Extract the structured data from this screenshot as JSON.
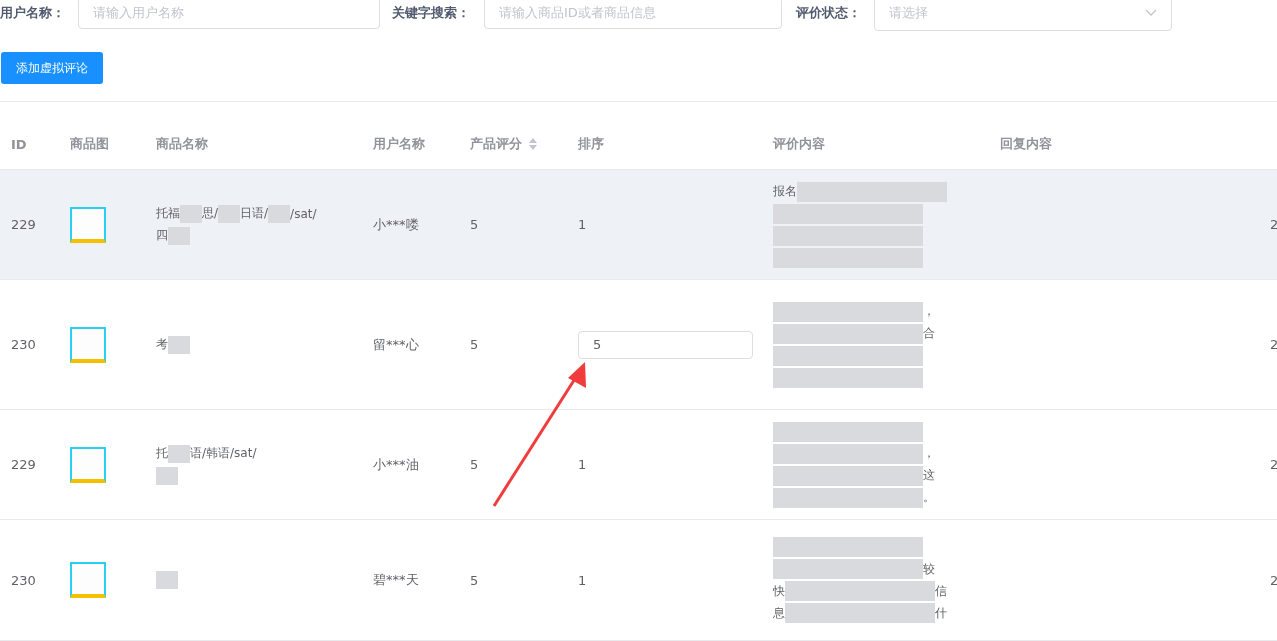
{
  "filters": [
    {
      "label": "用户名称：",
      "kind": "input",
      "placeholder": "请输入用户名称"
    },
    {
      "label": "关键字搜索：",
      "kind": "input",
      "placeholder": "请输入商品ID或者商品信息"
    },
    {
      "label": "评价状态：",
      "kind": "select",
      "placeholder": "请选择"
    }
  ],
  "add_button": "添加虚拟评论",
  "table": {
    "columns": [
      {
        "label": "ID",
        "sortable": false
      },
      {
        "label": "商品图",
        "sortable": false
      },
      {
        "label": "商品名称",
        "sortable": false
      },
      {
        "label": "用户名称",
        "sortable": false
      },
      {
        "label": "产品评分",
        "sortable": true
      },
      {
        "label": "排序",
        "sortable": false
      },
      {
        "label": "评价内容",
        "sortable": false
      },
      {
        "label": "回复内容",
        "sortable": false
      }
    ],
    "rows": [
      {
        "id": "229",
        "hovered": true,
        "name_lines": [
          [
            {
              "kind": "text",
              "text": "托福"
            },
            {
              "kind": "blur"
            },
            {
              "kind": "text",
              "text": "思/"
            },
            {
              "kind": "blur"
            },
            {
              "kind": "text",
              "text": "日语/"
            },
            {
              "kind": "blur"
            },
            {
              "kind": "text",
              "text": "/sat/"
            }
          ],
          [
            {
              "kind": "text",
              "text": "四"
            },
            {
              "kind": "blur"
            }
          ]
        ],
        "user": "小***喽",
        "score": "5",
        "sort": {
          "kind": "text",
          "value": "1"
        },
        "review_lines": [
          [
            {
              "kind": "text",
              "text": "报名"
            },
            {
              "kind": "blur"
            }
          ],
          [
            {
              "kind": "blur"
            }
          ],
          [
            {
              "kind": "blur"
            }
          ],
          [
            {
              "kind": "blur"
            }
          ]
        ],
        "column_9": "2"
      },
      {
        "id": "230",
        "hovered": false,
        "name_lines": [
          [
            {
              "kind": "text",
              "text": "考"
            },
            {
              "kind": "blur"
            }
          ]
        ],
        "user": "留***心",
        "score": "5",
        "sort": {
          "kind": "input",
          "value": "5"
        },
        "review_lines": [
          [
            {
              "kind": "blur"
            },
            {
              "kind": "text",
              "text": "，"
            }
          ],
          [
            {
              "kind": "blur"
            },
            {
              "kind": "text",
              "text": "合"
            }
          ],
          [
            {
              "kind": "blur"
            }
          ],
          [
            {
              "kind": "blur"
            }
          ]
        ],
        "column_9": "2"
      },
      {
        "id": "229",
        "hovered": false,
        "name_lines": [
          [
            {
              "kind": "text",
              "text": "托"
            },
            {
              "kind": "blur"
            },
            {
              "kind": "text",
              "text": "语/韩语/sat/"
            }
          ],
          [
            {
              "kind": "blur"
            }
          ]
        ],
        "user": "小***油",
        "score": "5",
        "sort": {
          "kind": "text",
          "value": "1"
        },
        "review_lines": [
          [
            {
              "kind": "blur"
            }
          ],
          [
            {
              "kind": "blur"
            },
            {
              "kind": "text",
              "text": "，"
            }
          ],
          [
            {
              "kind": "blur"
            },
            {
              "kind": "text",
              "text": "这"
            }
          ],
          [
            {
              "kind": "blur"
            },
            {
              "kind": "text",
              "text": "。"
            }
          ]
        ],
        "column_9": "2"
      },
      {
        "id": "230",
        "hovered": false,
        "name_lines": [
          [
            {
              "kind": "blur"
            }
          ]
        ],
        "user": "碧***天",
        "score": "5",
        "sort": {
          "kind": "text",
          "value": "1"
        },
        "review_lines": [
          [
            {
              "kind": "blur"
            }
          ],
          [
            {
              "kind": "blur"
            },
            {
              "kind": "text",
              "text": "较"
            }
          ],
          [
            {
              "kind": "text",
              "text": "快"
            },
            {
              "kind": "blur"
            },
            {
              "kind": "text",
              "text": "信"
            }
          ],
          [
            {
              "kind": "text",
              "text": "息"
            },
            {
              "kind": "blur"
            },
            {
              "kind": "text",
              "text": "什"
            }
          ]
        ],
        "column_9": "2"
      }
    ]
  }
}
